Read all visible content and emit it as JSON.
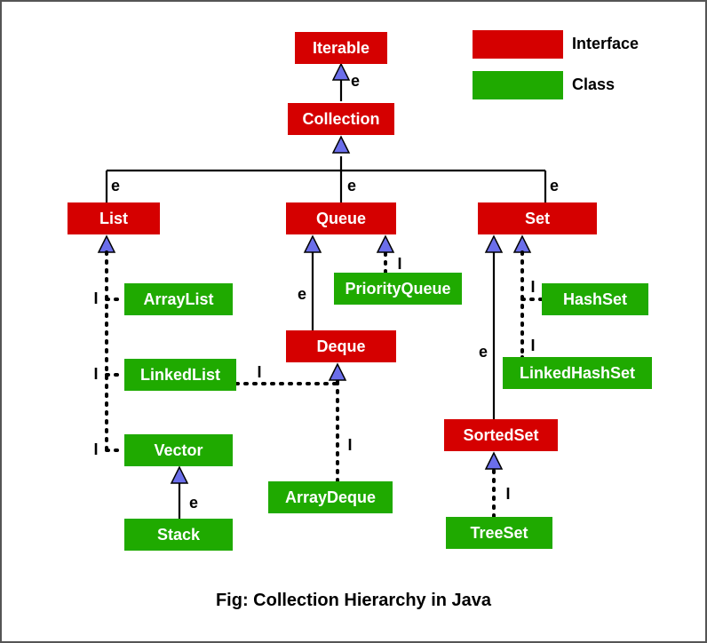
{
  "caption": "Fig:  Collection Hierarchy in Java",
  "legend": {
    "interface": "Interface",
    "class": "Class"
  },
  "colors": {
    "interface": "#d50000",
    "class": "#1faa00",
    "arrow": "#6b6eea"
  },
  "labels": {
    "extends": "e",
    "implements": "I"
  },
  "nodes": {
    "iterable": {
      "label": "Iterable",
      "kind": "interface"
    },
    "collection": {
      "label": "Collection",
      "kind": "interface"
    },
    "list": {
      "label": "List",
      "kind": "interface"
    },
    "queue": {
      "label": "Queue",
      "kind": "interface"
    },
    "set": {
      "label": "Set",
      "kind": "interface"
    },
    "deque": {
      "label": "Deque",
      "kind": "interface"
    },
    "sortedset": {
      "label": "SortedSet",
      "kind": "interface"
    },
    "arraylist": {
      "label": "ArrayList",
      "kind": "class"
    },
    "linkedlist": {
      "label": "LinkedList",
      "kind": "class"
    },
    "vector": {
      "label": "Vector",
      "kind": "class"
    },
    "stack": {
      "label": "Stack",
      "kind": "class"
    },
    "priorityqueue": {
      "label": "PriorityQueue",
      "kind": "class"
    },
    "arraydeque": {
      "label": "ArrayDeque",
      "kind": "class"
    },
    "hashset": {
      "label": "HashSet",
      "kind": "class"
    },
    "linkedhashset": {
      "label": "LinkedHashSet",
      "kind": "class"
    },
    "treeset": {
      "label": "TreeSet",
      "kind": "class"
    }
  },
  "edges": [
    {
      "from": "collection",
      "to": "iterable",
      "kind": "extends"
    },
    {
      "from": "list",
      "to": "collection",
      "kind": "extends"
    },
    {
      "from": "queue",
      "to": "collection",
      "kind": "extends"
    },
    {
      "from": "set",
      "to": "collection",
      "kind": "extends"
    },
    {
      "from": "deque",
      "to": "queue",
      "kind": "extends"
    },
    {
      "from": "sortedset",
      "to": "set",
      "kind": "extends"
    },
    {
      "from": "stack",
      "to": "vector",
      "kind": "extends"
    },
    {
      "from": "arraylist",
      "to": "list",
      "kind": "implements"
    },
    {
      "from": "linkedlist",
      "to": "list",
      "kind": "implements"
    },
    {
      "from": "vector",
      "to": "list",
      "kind": "implements"
    },
    {
      "from": "linkedlist",
      "to": "deque",
      "kind": "implements"
    },
    {
      "from": "arraydeque",
      "to": "deque",
      "kind": "implements"
    },
    {
      "from": "priorityqueue",
      "to": "queue",
      "kind": "implements"
    },
    {
      "from": "hashset",
      "to": "set",
      "kind": "implements"
    },
    {
      "from": "linkedhashset",
      "to": "set",
      "kind": "implements"
    },
    {
      "from": "treeset",
      "to": "sortedset",
      "kind": "implements"
    }
  ]
}
